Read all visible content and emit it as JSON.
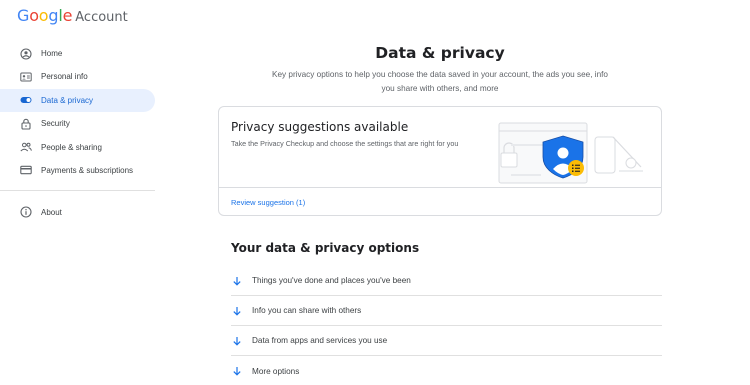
{
  "header": {
    "logo_letters": [
      "G",
      "o",
      "o",
      "g",
      "l",
      "e"
    ],
    "app_name": "Account"
  },
  "sidebar": {
    "items": [
      {
        "label": "Home",
        "icon": "home-icon"
      },
      {
        "label": "Personal info",
        "icon": "id-card-icon"
      },
      {
        "label": "Data & privacy",
        "icon": "toggle-icon",
        "active": true
      },
      {
        "label": "Security",
        "icon": "lock-icon"
      },
      {
        "label": "People & sharing",
        "icon": "people-icon"
      },
      {
        "label": "Payments & subscriptions",
        "icon": "credit-card-icon"
      }
    ],
    "about": {
      "label": "About",
      "icon": "info-icon"
    }
  },
  "main": {
    "title": "Data & privacy",
    "subtitle": "Key privacy options to help you choose the data saved in your account, the ads you see, info you share with others, and more"
  },
  "privacy_card": {
    "title": "Privacy suggestions available",
    "description": "Take the Privacy Checkup and choose the settings that are right for you",
    "link": "Review suggestion (1)"
  },
  "options_section": {
    "title": "Your data & privacy options",
    "items": [
      {
        "label": "Things you've done and places you've been"
      },
      {
        "label": "Info you can share with others"
      },
      {
        "label": "Data from apps and services you use"
      },
      {
        "label": "More options"
      }
    ]
  },
  "colors": {
    "accent": "#1a73e8",
    "active_bg": "#e8f0fe",
    "shield_blue": "#1a73e8",
    "badge_yellow": "#fbbc04"
  }
}
